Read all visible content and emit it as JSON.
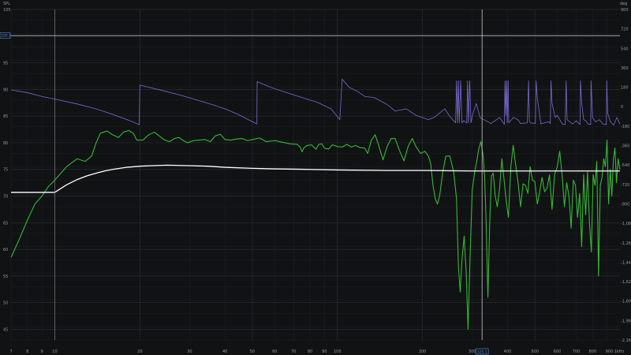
{
  "chart_data": {
    "type": "line",
    "left_unit": "SPL",
    "right_unit": "deg",
    "x_unit_label": "Hz",
    "x_scale": "log",
    "xlim": [
      7,
      1000
    ],
    "ylim_left": [
      43,
      105
    ],
    "ylim_right": [
      -2160,
      900
    ],
    "left_ticks": [
      "105",
      "100",
      "95",
      "90",
      "85",
      "80",
      "75",
      "70",
      "65",
      "60",
      "55",
      "50",
      "45"
    ],
    "right_ticks": [
      "900",
      "720",
      "540",
      "360",
      "180",
      "0",
      "-180",
      "-360",
      "-540",
      "-720",
      "-900",
      "-1,080",
      "-1,260",
      "-1,440",
      "-1,620",
      "-1,800",
      "-1,980",
      "-2,160"
    ],
    "x_ticks": [
      "7",
      "8",
      "9",
      "10",
      "20",
      "30",
      "40",
      "50",
      "60",
      "70",
      "80",
      "90",
      "100",
      "200",
      "300",
      "400",
      "500",
      "600",
      "700",
      "800",
      "900 1kHz"
    ],
    "cursor": {
      "x_label": "325.1",
      "y_label": "100.1",
      "x_value": 325.1,
      "y_value": 100.1
    },
    "reference_x": 10,
    "colors": {
      "spl": "#36b836",
      "phase": "#7a6ad0",
      "target": "#ffffff",
      "cursor": "#c8c8c8",
      "cursor_label": "#5a8fd6",
      "grid": "#2a2c30",
      "background": "#111214"
    },
    "series": [
      {
        "key": "spl",
        "axis": "left",
        "points": [
          [
            7,
            58.5
          ],
          [
            7.5,
            62
          ],
          [
            8,
            65.5
          ],
          [
            8.5,
            68.5
          ],
          [
            9,
            70
          ],
          [
            9.5,
            71.8
          ],
          [
            10,
            73
          ],
          [
            11,
            75.5
          ],
          [
            12,
            77
          ],
          [
            12.8,
            76.5
          ],
          [
            13.5,
            77.5
          ],
          [
            14,
            80
          ],
          [
            14.5,
            81.8
          ],
          [
            15.3,
            82.2
          ],
          [
            16,
            81.5
          ],
          [
            16.8,
            81
          ],
          [
            17.5,
            82
          ],
          [
            18.3,
            82.3
          ],
          [
            19,
            81.7
          ],
          [
            19.5,
            80.5
          ],
          [
            20.5,
            80.5
          ],
          [
            21.5,
            81.5
          ],
          [
            22.5,
            82
          ],
          [
            23.5,
            81.2
          ],
          [
            24.5,
            80.5
          ],
          [
            25.5,
            80.2
          ],
          [
            26.5,
            80.8
          ],
          [
            27.5,
            81
          ],
          [
            28.5,
            80.4
          ],
          [
            29.5,
            80
          ],
          [
            31,
            80.4
          ],
          [
            32.5,
            80.5
          ],
          [
            34,
            80.6
          ],
          [
            35.5,
            80.2
          ],
          [
            37,
            81.3
          ],
          [
            38.5,
            81.6
          ],
          [
            40,
            80.6
          ],
          [
            42,
            80.5
          ],
          [
            44,
            80.7
          ],
          [
            46,
            80.8
          ],
          [
            48,
            80.4
          ],
          [
            50,
            80.6
          ],
          [
            53,
            80.9
          ],
          [
            56,
            80.2
          ],
          [
            60,
            80.4
          ],
          [
            64,
            80.1
          ],
          [
            68,
            79.8
          ],
          [
            72,
            79.7
          ],
          [
            74,
            79.1
          ],
          [
            75,
            78.3
          ],
          [
            76,
            79
          ],
          [
            78,
            79.5
          ],
          [
            81,
            79.6
          ],
          [
            84,
            78.8
          ],
          [
            86,
            79.7
          ],
          [
            88,
            79.8
          ],
          [
            90,
            79
          ],
          [
            93,
            78.8
          ],
          [
            96,
            79.6
          ],
          [
            100,
            79.3
          ],
          [
            104,
            79.2
          ],
          [
            108,
            79.7
          ],
          [
            112,
            79.2
          ],
          [
            116,
            79.5
          ],
          [
            120,
            79.1
          ],
          [
            125,
            79
          ],
          [
            128,
            78
          ],
          [
            132,
            80.5
          ],
          [
            136,
            81.5
          ],
          [
            140,
            79.5
          ],
          [
            145,
            76.8
          ],
          [
            150,
            79.3
          ],
          [
            155,
            80.8
          ],
          [
            160,
            80.8
          ],
          [
            166,
            78.5
          ],
          [
            172,
            76.6
          ],
          [
            178,
            79.3
          ],
          [
            184,
            80.8
          ],
          [
            190,
            79.2
          ],
          [
            197,
            78
          ],
          [
            204,
            78.4
          ],
          [
            210,
            77.5
          ],
          [
            214,
            76
          ],
          [
            218,
            72
          ],
          [
            222,
            69.5
          ],
          [
            226,
            68.5
          ],
          [
            230,
            70
          ],
          [
            236,
            74.5
          ],
          [
            242,
            77.5
          ],
          [
            250,
            77.5
          ],
          [
            258,
            74.5
          ],
          [
            264,
            69.5
          ],
          [
            268,
            57
          ],
          [
            272,
            52
          ],
          [
            276,
            58
          ],
          [
            281,
            62.5
          ],
          [
            286,
            55
          ],
          [
            290,
            45
          ],
          [
            295,
            59
          ],
          [
            300,
            71
          ],
          [
            306,
            74.5
          ],
          [
            312,
            76.8
          ],
          [
            316,
            78.7
          ],
          [
            322,
            80.2
          ],
          [
            328,
            77.5
          ],
          [
            332,
            73.5
          ],
          [
            336,
            65.2
          ],
          [
            341,
            51
          ],
          [
            346,
            65
          ],
          [
            351,
            73.8
          ],
          [
            356,
            74.3
          ],
          [
            362,
            70
          ],
          [
            368,
            68
          ],
          [
            375,
            71.5
          ],
          [
            382,
            77
          ],
          [
            389,
            73
          ],
          [
            396,
            69
          ],
          [
            403,
            66
          ],
          [
            411,
            75.5
          ],
          [
            419,
            79.5
          ],
          [
            427,
            76
          ],
          [
            436,
            72.5
          ],
          [
            445,
            68
          ],
          [
            454,
            72.3
          ],
          [
            463,
            72
          ],
          [
            472,
            70.5
          ],
          [
            481,
            75.5
          ],
          [
            490,
            73
          ],
          [
            500,
            72.7
          ],
          [
            510,
            68.5
          ],
          [
            520,
            70.8
          ],
          [
            530,
            73.5
          ],
          [
            541,
            70.8
          ],
          [
            552,
            71.5
          ],
          [
            563,
            74
          ],
          [
            575,
            67.5
          ],
          [
            587,
            74
          ],
          [
            600,
            75.5
          ],
          [
            612,
            78.4
          ],
          [
            624,
            74
          ],
          [
            636,
            68
          ],
          [
            648,
            72.5
          ],
          [
            660,
            70
          ],
          [
            672,
            64
          ],
          [
            684,
            73
          ],
          [
            696,
            72
          ],
          [
            708,
            66
          ],
          [
            720,
            70.5
          ],
          [
            732,
            60.5
          ],
          [
            744,
            74
          ],
          [
            756,
            66.5
          ],
          [
            768,
            74.5
          ],
          [
            780,
            65
          ],
          [
            792,
            59.5
          ],
          [
            804,
            74
          ],
          [
            816,
            72
          ],
          [
            828,
            76.5
          ],
          [
            840,
            55
          ],
          [
            852,
            72
          ],
          [
            864,
            73.5
          ],
          [
            876,
            77
          ],
          [
            888,
            75.5
          ],
          [
            900,
            80.5
          ],
          [
            912,
            68.5
          ],
          [
            924,
            75
          ],
          [
            936,
            70
          ],
          [
            948,
            77
          ],
          [
            960,
            79
          ],
          [
            972,
            72.5
          ],
          [
            985,
            77
          ],
          [
            1000,
            75
          ]
        ]
      },
      {
        "key": "phase",
        "axis": "right",
        "points": [
          [
            7,
            155
          ],
          [
            8,
            130
          ],
          [
            9,
            95
          ],
          [
            10,
            70
          ],
          [
            12,
            25
          ],
          [
            14,
            -20
          ],
          [
            16,
            -70
          ],
          [
            18,
            -120
          ],
          [
            19.9,
            -165
          ],
          [
            20,
            200
          ],
          [
            24,
            150
          ],
          [
            28,
            105
          ],
          [
            32,
            60
          ],
          [
            36,
            20
          ],
          [
            40,
            -20
          ],
          [
            44,
            -65
          ],
          [
            48,
            -115
          ],
          [
            51.9,
            -160
          ],
          [
            52,
            232
          ],
          [
            58,
            180
          ],
          [
            66,
            130
          ],
          [
            75,
            85
          ],
          [
            85,
            40
          ],
          [
            95,
            -20
          ],
          [
            102,
            -120
          ],
          [
            104,
            255
          ],
          [
            110,
            180
          ],
          [
            118,
            140
          ],
          [
            125,
            95
          ],
          [
            135,
            85
          ],
          [
            150,
            20
          ],
          [
            160,
            -40
          ],
          [
            175,
            -20
          ],
          [
            190,
            -80
          ],
          [
            210,
            -120
          ],
          [
            220,
            -100
          ],
          [
            240,
            -20
          ],
          [
            250,
            -90
          ],
          [
            262,
            -150
          ],
          [
            264,
            240
          ],
          [
            266,
            -150
          ],
          [
            268,
            240
          ],
          [
            270,
            -150
          ],
          [
            273,
            240
          ],
          [
            276,
            -150
          ],
          [
            280,
            -130
          ],
          [
            287,
            -150
          ],
          [
            289,
            240
          ],
          [
            291,
            -150
          ],
          [
            294,
            240
          ],
          [
            297,
            -150
          ],
          [
            302,
            -60
          ],
          [
            310,
            30
          ],
          [
            320,
            -100
          ],
          [
            330,
            -120
          ],
          [
            350,
            -155
          ],
          [
            375,
            -100
          ],
          [
            390,
            -165
          ],
          [
            392,
            240
          ],
          [
            394,
            -80
          ],
          [
            397,
            240
          ],
          [
            399,
            -150
          ],
          [
            402,
            240
          ],
          [
            404,
            -150
          ],
          [
            420,
            -100
          ],
          [
            435,
            -120
          ],
          [
            445,
            -155
          ],
          [
            470,
            -150
          ],
          [
            475,
            240
          ],
          [
            478,
            -130
          ],
          [
            482,
            -150
          ],
          [
            502,
            -155
          ],
          [
            505,
            240
          ],
          [
            510,
            80
          ],
          [
            525,
            -160
          ],
          [
            540,
            -150
          ],
          [
            560,
            -140
          ],
          [
            567,
            -155
          ],
          [
            570,
            240
          ],
          [
            575,
            30
          ],
          [
            590,
            -100
          ],
          [
            600,
            -80
          ],
          [
            625,
            -160
          ],
          [
            640,
            -165
          ],
          [
            645,
            240
          ],
          [
            650,
            -120
          ],
          [
            665,
            -140
          ],
          [
            680,
            -160
          ],
          [
            700,
            -130
          ],
          [
            722,
            -165
          ],
          [
            725,
            240
          ],
          [
            732,
            30
          ],
          [
            744,
            -120
          ],
          [
            758,
            -130
          ],
          [
            770,
            -160
          ],
          [
            788,
            -165
          ],
          [
            790,
            240
          ],
          [
            800,
            -100
          ],
          [
            820,
            -140
          ],
          [
            845,
            -120
          ],
          [
            870,
            -160
          ],
          [
            895,
            -165
          ],
          [
            898,
            240
          ],
          [
            905,
            -60
          ],
          [
            925,
            -140
          ],
          [
            950,
            -170
          ],
          [
            975,
            -100
          ],
          [
            1000,
            -160
          ]
        ]
      },
      {
        "key": "target",
        "axis": "left",
        "points": [
          [
            7,
            70.7
          ],
          [
            8,
            70.7
          ],
          [
            9,
            70.7
          ],
          [
            10,
            70.7
          ],
          [
            11,
            72.1
          ],
          [
            12,
            73.1
          ],
          [
            13,
            73.8
          ],
          [
            14,
            74.3
          ],
          [
            15,
            74.7
          ],
          [
            16,
            75
          ],
          [
            18,
            75.4
          ],
          [
            20,
            75.6
          ],
          [
            22,
            75.7
          ],
          [
            25,
            75.8
          ],
          [
            30,
            75.7
          ],
          [
            35,
            75.6
          ],
          [
            40,
            75.4
          ],
          [
            50,
            75.2
          ],
          [
            60,
            75.1
          ],
          [
            80,
            75
          ],
          [
            100,
            74.9
          ],
          [
            150,
            74.8
          ],
          [
            200,
            74.8
          ],
          [
            300,
            74.7
          ],
          [
            500,
            74.7
          ],
          [
            1000,
            74.7
          ]
        ]
      }
    ]
  }
}
